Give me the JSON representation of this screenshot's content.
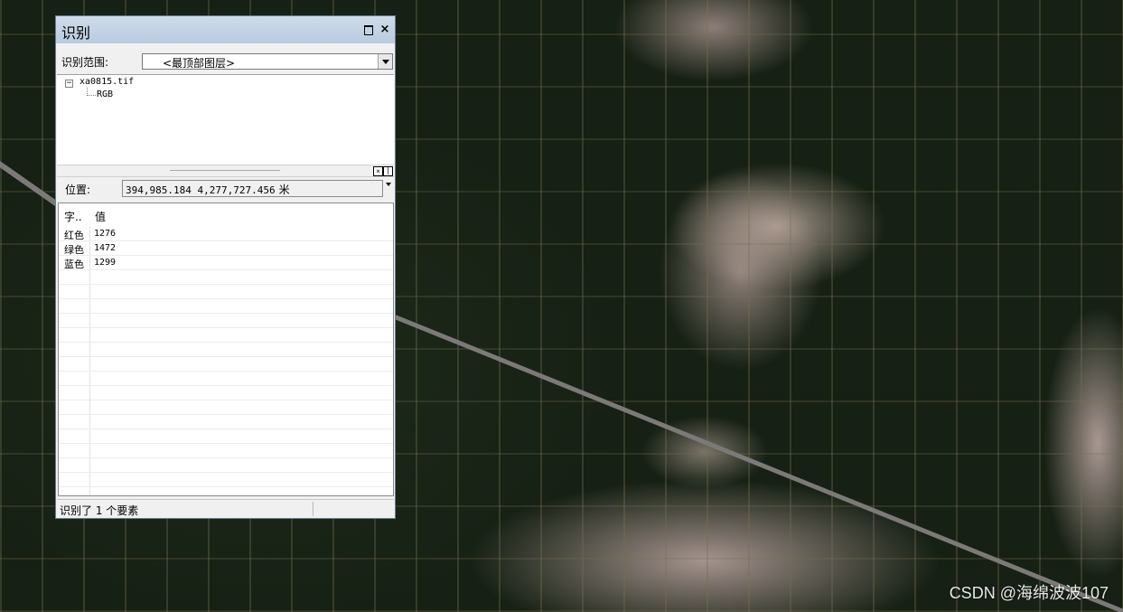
{
  "window": {
    "title": "识别",
    "maximize_label": "",
    "close_label": "×"
  },
  "scope": {
    "label": "识别范围:",
    "selected": "<最顶部图层>"
  },
  "tree": {
    "expander": "−",
    "root": "xa0815.tif",
    "child": "RGB"
  },
  "splitter": {
    "btn_a": "⌅",
    "btn_b": "|"
  },
  "position": {
    "label": "位置:",
    "value": "394,985.184  4,277,727.456",
    "unit": "米"
  },
  "table": {
    "columns": [
      "字..",
      "值"
    ],
    "rows": [
      {
        "field": "红色",
        "value": "1276"
      },
      {
        "field": "绿色",
        "value": "1472"
      },
      {
        "field": "蓝色",
        "value": "1299"
      }
    ],
    "empty_rows": 15
  },
  "status": {
    "text": "识别了 1 个要素"
  },
  "watermark": "CSDN @海绵波波107"
}
